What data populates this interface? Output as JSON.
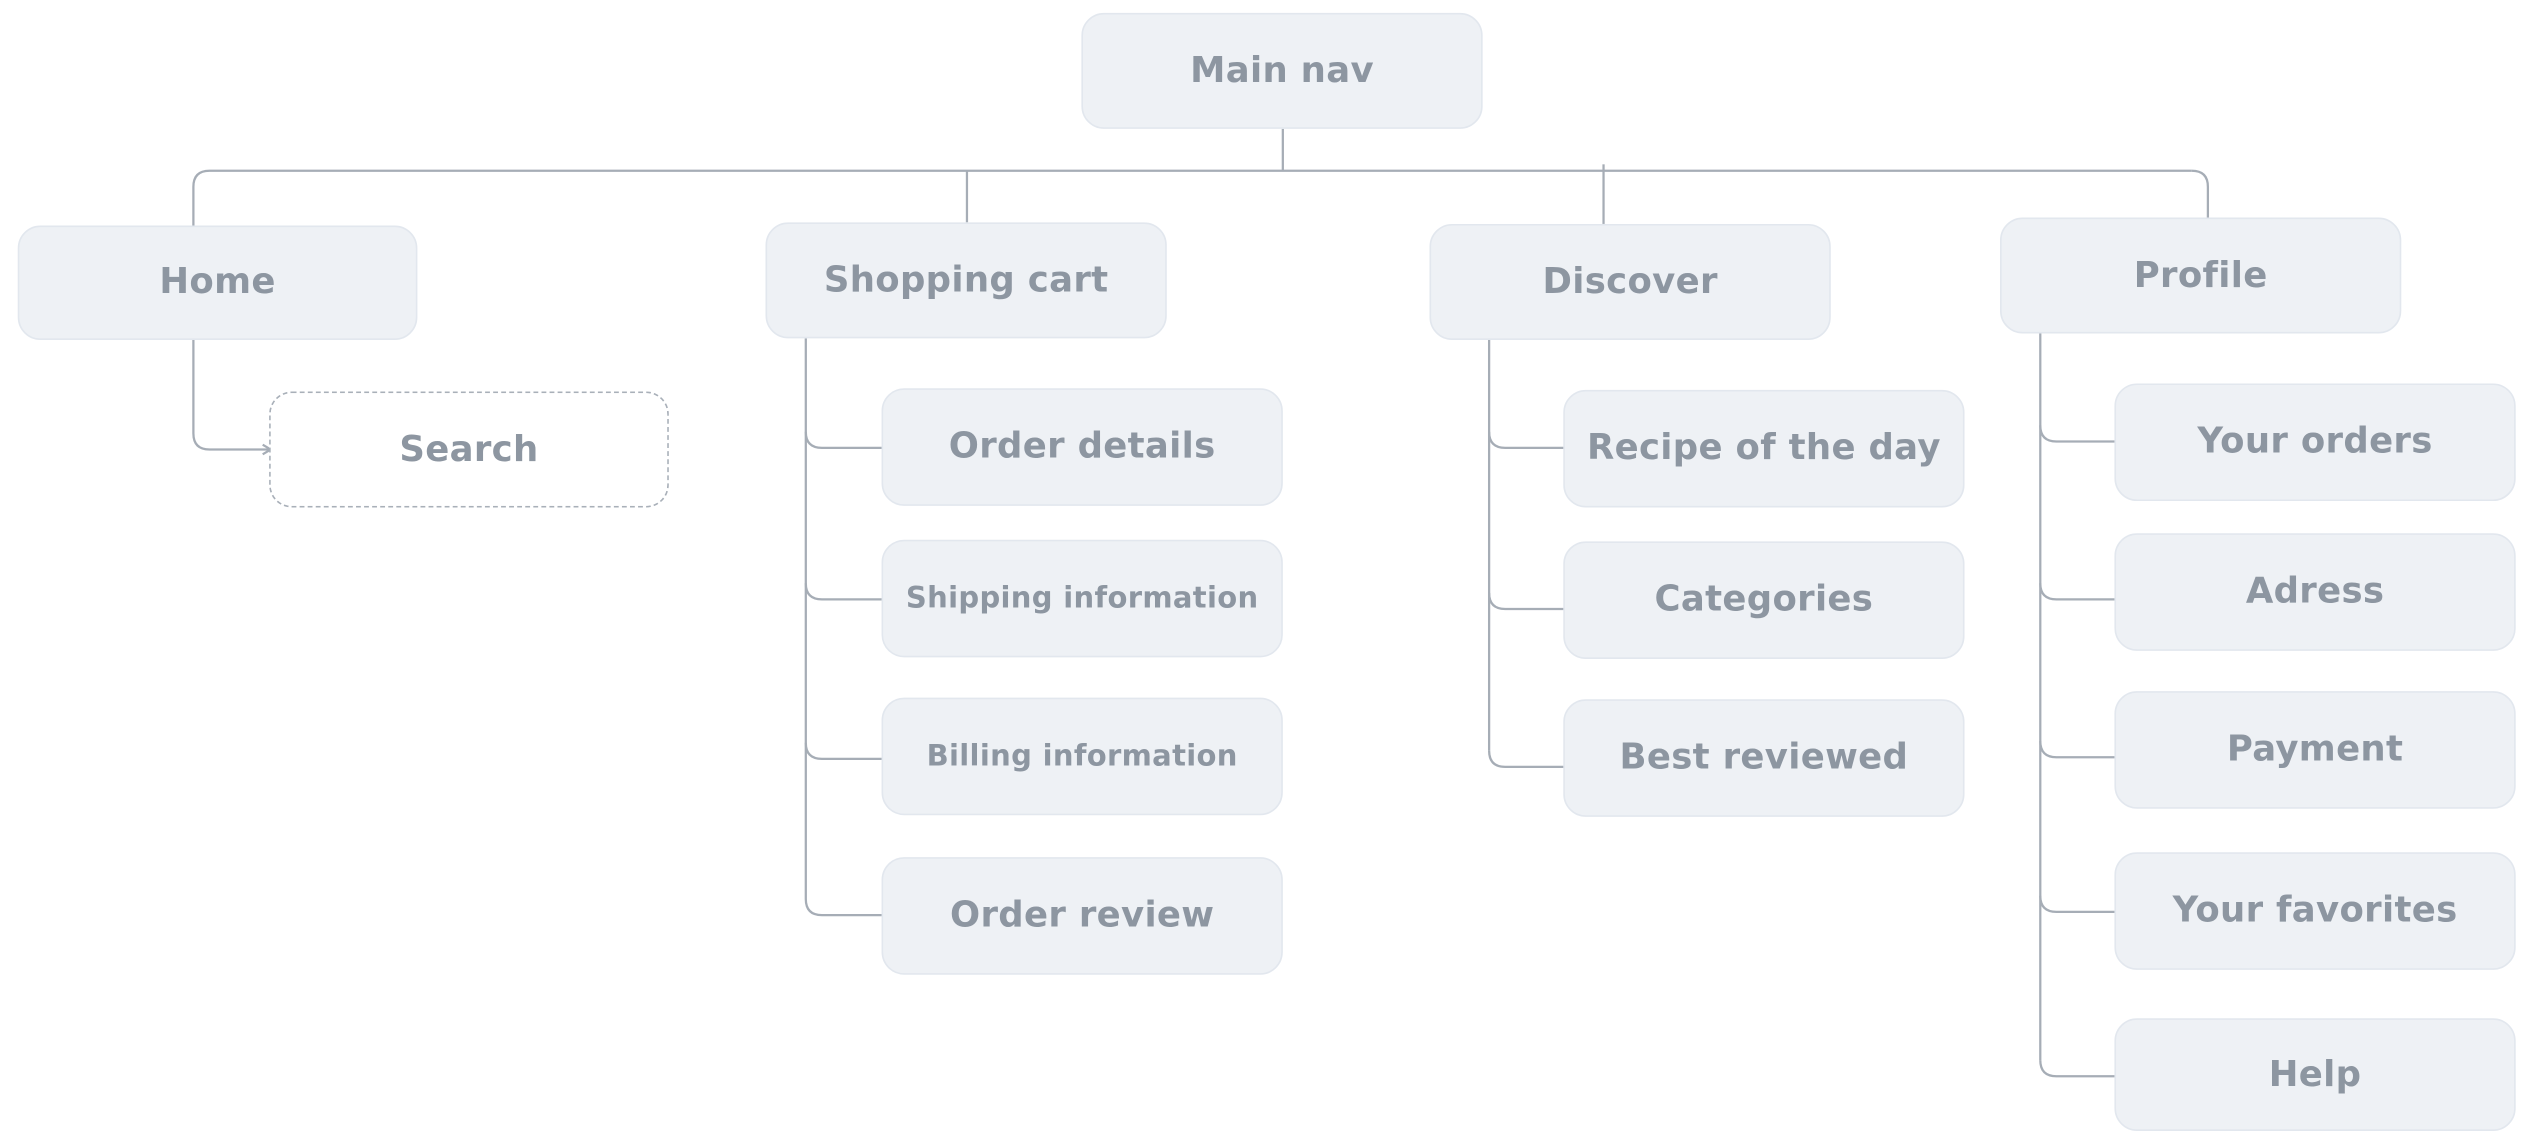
{
  "diagram": {
    "root": "Main nav",
    "home": {
      "label": "Home",
      "children": [
        "Search"
      ]
    },
    "cart": {
      "label": "Shopping cart",
      "children": [
        "Order details",
        "Shipping information",
        "Billing information",
        "Order review"
      ]
    },
    "discover": {
      "label": "Discover",
      "children": [
        "Recipe of the day",
        "Categories",
        "Best reviewed"
      ]
    },
    "profile": {
      "label": "Profile",
      "children": [
        "Your orders",
        "Adress",
        "Payment",
        "Your favorites",
        "Help"
      ]
    }
  },
  "colors": {
    "node_fill": "#eef1f5",
    "node_text": "#8d96a1",
    "connector": "#a6adb6",
    "dashed_border": "#a9b0b9"
  }
}
